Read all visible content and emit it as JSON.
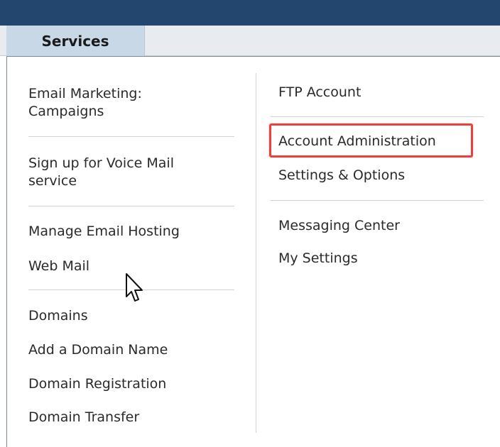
{
  "tabs": {
    "services_label": "Services"
  },
  "left_column": {
    "email_marketing_label": "Email Marketing:\nCampaigns",
    "voice_mail_label": "Sign up for Voice Mail\nservice",
    "manage_email_hosting_label": "Manage Email Hosting",
    "web_mail_label": "Web Mail",
    "domains_label": "Domains",
    "add_domain_label": "Add a Domain Name",
    "domain_registration_label": "Domain Registration",
    "domain_transfer_label": "Domain Transfer"
  },
  "right_column": {
    "ftp_account_label": "FTP Account",
    "account_administration_label": "Account Administration",
    "settings_options_label": "Settings & Options",
    "messaging_center_label": "Messaging Center",
    "my_settings_label": "My Settings"
  },
  "colors": {
    "topbar": "#23466e",
    "active_tab": "#c8d8e6",
    "highlight": "#e8413e"
  },
  "icons": {
    "cursor": "mouse-pointer-icon"
  }
}
